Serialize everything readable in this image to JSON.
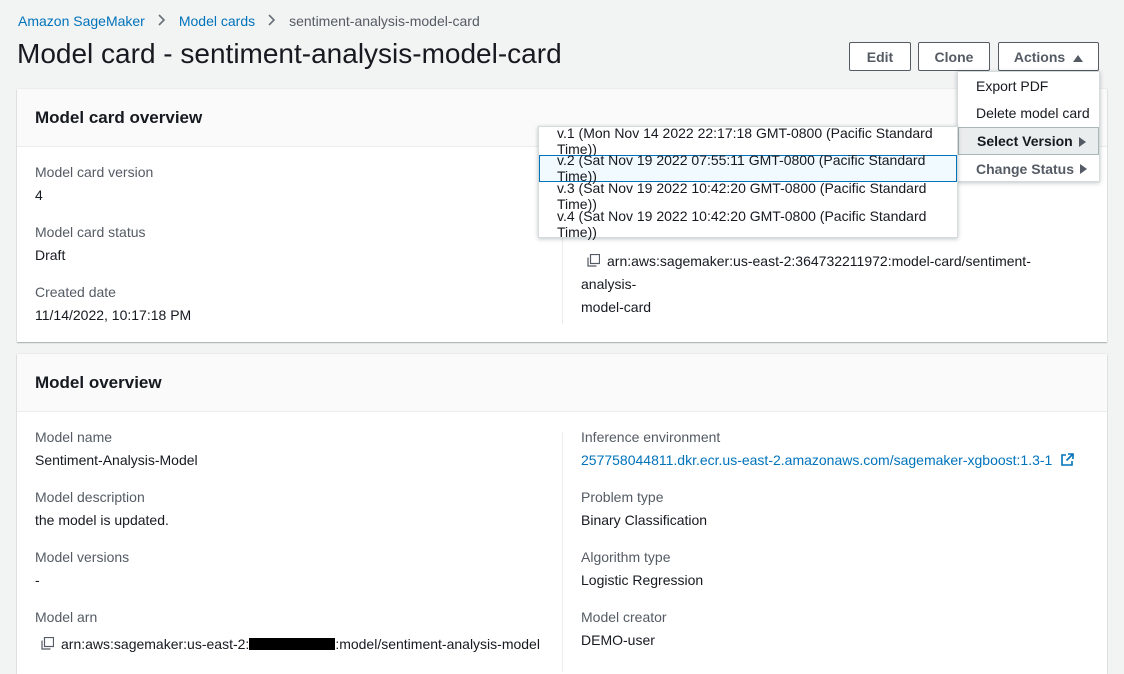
{
  "breadcrumb": {
    "items": [
      "Amazon SageMaker",
      "Model cards",
      "sentiment-analysis-model-card"
    ]
  },
  "page_title": "Model card - sentiment-analysis-model-card",
  "header_buttons": {
    "edit": "Edit",
    "clone": "Clone",
    "actions": "Actions"
  },
  "actions_menu": {
    "items": [
      "Export PDF",
      "Delete model card",
      "Select Version",
      "Change Status"
    ]
  },
  "version_menu": {
    "items": [
      "v.1 (Mon Nov 14 2022 22:17:18 GMT-0800 (Pacific Standard Time))",
      "v.2 (Sat Nov 19 2022 07:55:11 GMT-0800 (Pacific Standard Time))",
      "v.3 (Sat Nov 19 2022 10:42:20 GMT-0800 (Pacific Standard Time))",
      "v.4 (Sat Nov 19 2022 10:42:20 GMT-0800 (Pacific Standard Time))"
    ],
    "highlighted_index": 1
  },
  "model_card_overview": {
    "title": "Model card overview",
    "version_label": "Model card version",
    "version_value": "4",
    "status_label": "Model card status",
    "status_value": "Draft",
    "created_label": "Created date",
    "created_value": "11/14/2022, 10:17:18 PM",
    "arn_line1": "arn:aws:sagemaker:us-east-2:364732211972:model-card/sentiment-analysis-",
    "arn_line2": "model-card"
  },
  "model_overview": {
    "title": "Model overview",
    "model_name_label": "Model name",
    "model_name_value": "Sentiment-Analysis-Model",
    "model_description_label": "Model description",
    "model_description_value": "the model is updated.",
    "model_versions_label": "Model versions",
    "model_versions_value": "-",
    "model_arn_label": "Model arn",
    "model_arn_prefix": "arn:aws:sagemaker:us-east-2:",
    "model_arn_suffix": ":model/sentiment-analysis-model",
    "inference_env_label": "Inference environment",
    "inference_env_value": "257758044811.dkr.ecr.us-east-2.amazonaws.com/sagemaker-xgboost:1.3-1",
    "problem_type_label": "Problem type",
    "problem_type_value": "Binary Classification",
    "algorithm_type_label": "Algorithm type",
    "algorithm_type_value": "Logistic Regression",
    "model_creator_label": "Model creator",
    "model_creator_value": "DEMO-user"
  },
  "colors": {
    "link": "#0073bb",
    "border": "#eaeded",
    "highlight": "#0073bb"
  }
}
